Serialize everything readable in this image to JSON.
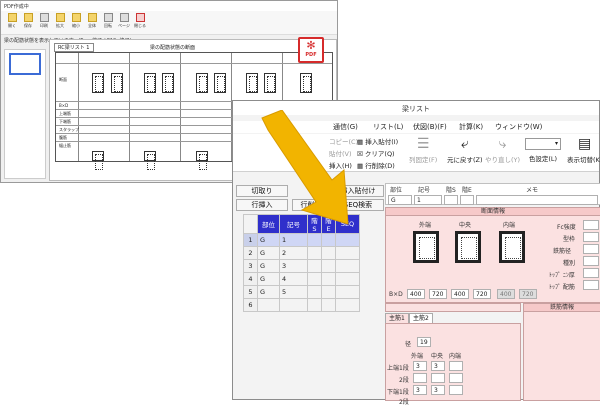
{
  "pdf_window": {
    "title": "PDF作成中",
    "status": "梁の配筋状態を表示しています。(Esc: 終了 / F10: 終了)",
    "doc_header": "RC梁リスト  1",
    "doc_title": "梁の配筋状態の断面",
    "toolbar": [
      "開く",
      "保存",
      "印刷",
      "拡大",
      "縮小",
      "全体",
      "回転",
      "ページ",
      "閉じる"
    ],
    "pdf_badge": "PDF",
    "row_labels": [
      "断面",
      "B×D",
      "上端筋",
      "下端筋",
      "スタラップ",
      "腹筋",
      "幅止筋"
    ]
  },
  "main_window": {
    "title": "梁リスト",
    "menu": [
      "通信(G)",
      "リスト(L)",
      "伏図(B)(F)",
      "計算(K)",
      "ウィンドウ(W)"
    ],
    "ribbon": {
      "left_small": [
        "コピー(C)",
        "貼付(V)",
        "挿入(H)"
      ],
      "mid_small": [
        "挿入貼付(I)",
        "クリア(Q)",
        "行削除(D)"
      ],
      "list_fixed": "列固定(F)",
      "undo": "元に戻す(Z)",
      "redo": "やり直し(Y)",
      "color": "色設定(L)",
      "display": "表示切替(K)"
    },
    "buttons": {
      "cut": "切取り",
      "insert_paste": "挿入貼付け",
      "row_insert": "行挿入",
      "row_delete": "行削除",
      "seq_search": "SEQ検索"
    },
    "grid": {
      "headers": [
        "部位",
        "記号",
        "階S",
        "階E",
        "SEQ"
      ],
      "rows": [
        {
          "n": "1",
          "part": "G",
          "sym": "1"
        },
        {
          "n": "2",
          "part": "G",
          "sym": "2"
        },
        {
          "n": "3",
          "part": "G",
          "sym": "3"
        },
        {
          "n": "4",
          "part": "G",
          "sym": "4"
        },
        {
          "n": "5",
          "part": "G",
          "sym": "5"
        },
        {
          "n": "6",
          "part": "",
          "sym": ""
        }
      ]
    },
    "form": {
      "head_labels": [
        "部位",
        "記号",
        "階S",
        "階E",
        "メモ"
      ],
      "head_values": [
        "G",
        "1",
        "",
        "",
        ""
      ],
      "section_title": "断面情報",
      "section_cols": [
        "外端",
        "中央",
        "内端"
      ],
      "bxd_label": "B×D",
      "bxd": [
        "400",
        "720",
        "400",
        "720",
        "400",
        "720"
      ],
      "side_labels": [
        "Fc強度",
        "型枠",
        "鉄筋径",
        "種別",
        "ﾄｯﾌﾟ ﾆﾝ厚",
        "ﾄｯﾌﾟ 配筋"
      ],
      "tabs": [
        "主筋1",
        "主筋2"
      ],
      "rebar_title": "鉄筋情報",
      "diameter_label": "径",
      "diameter_value": "19",
      "rebar_cols": [
        "外端",
        "中央",
        "内端"
      ],
      "rebar_rows": [
        {
          "label": "上端",
          "sub": "1段",
          "v": [
            "3",
            "3",
            ""
          ]
        },
        {
          "label": "",
          "sub": "2段",
          "v": [
            "",
            "",
            ""
          ]
        },
        {
          "label": "下端",
          "sub": "1段",
          "v": [
            "3",
            "3",
            ""
          ]
        },
        {
          "label": "",
          "sub": "2段",
          "v": [
            "",
            "",
            ""
          ]
        }
      ]
    }
  },
  "colors": {
    "grid_header": "#2f2fcb",
    "arrow": "#f2b400",
    "pdf_red": "#d62b2b",
    "form_pink": "#fbe1e1"
  }
}
